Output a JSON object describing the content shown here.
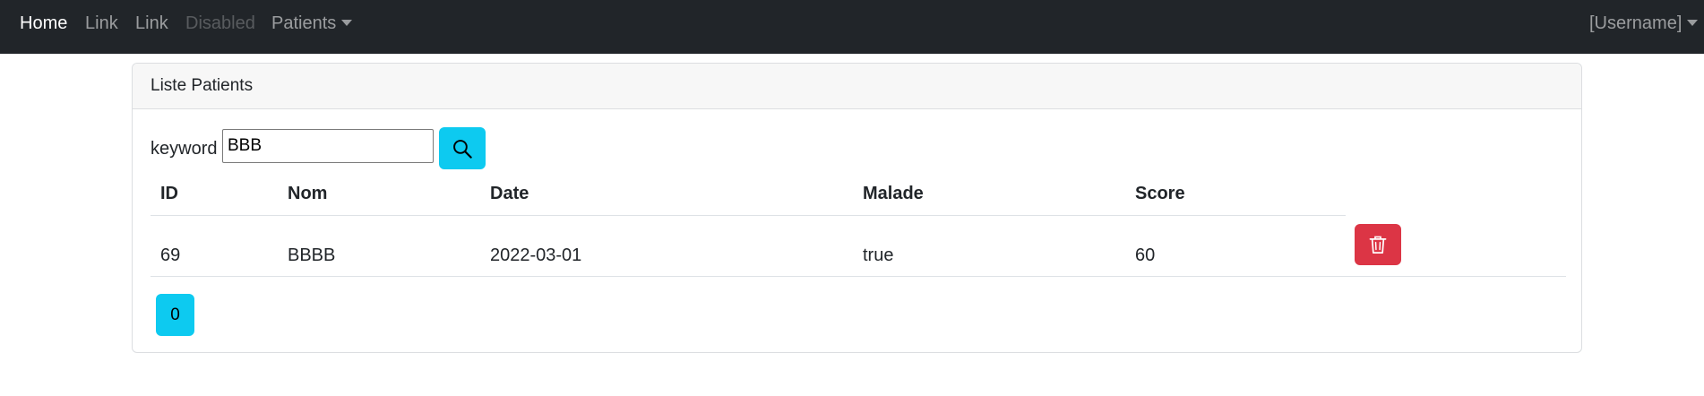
{
  "navbar": {
    "home": "Home",
    "link1": "Link",
    "link2": "Link",
    "disabled": "Disabled",
    "patients": "Patients",
    "username": "[Username]"
  },
  "card": {
    "title": "Liste Patients"
  },
  "search": {
    "label": "keyword",
    "value": "BBB",
    "icon": "search-icon"
  },
  "table": {
    "columns": [
      "ID",
      "Nom",
      "Date",
      "Malade",
      "Score"
    ],
    "rows": [
      {
        "id": "69",
        "nom": "BBBB",
        "date": "2022-03-01",
        "malade": "true",
        "score": "60"
      }
    ],
    "delete_icon": "trash-icon"
  },
  "pagination": {
    "pages": [
      "0"
    ]
  },
  "colors": {
    "navbar_bg": "#212529",
    "info": "#0dcaf0",
    "danger": "#dc3545"
  }
}
